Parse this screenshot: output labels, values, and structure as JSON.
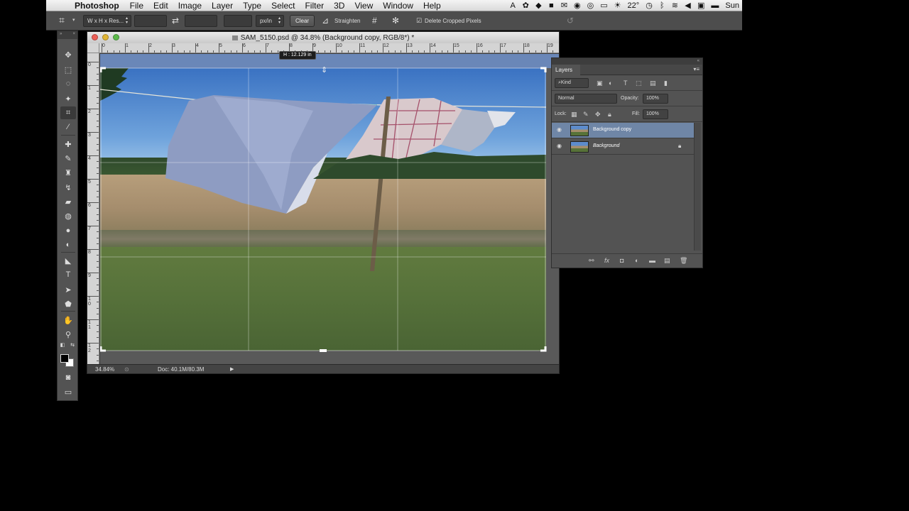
{
  "menubar": {
    "apple_icon": "apple-icon",
    "app_name": "Photoshop",
    "menus": [
      "File",
      "Edit",
      "Image",
      "Layer",
      "Type",
      "Select",
      "Filter",
      "3D",
      "View",
      "Window",
      "Help"
    ],
    "temperature": "22°",
    "day": "Sun"
  },
  "options_bar": {
    "ratio_preset": "W x H x Res...",
    "width_value": "",
    "height_value": "",
    "resolution_value": "",
    "resolution_unit": "px/in",
    "clear_label": "Clear",
    "straighten_label": "Straighten",
    "delete_cropped_label": "Delete Cropped Pixels",
    "delete_cropped_checked": true
  },
  "document": {
    "title": "SAM_5150.psd @ 34.8% (Background copy, RGB/8*) *",
    "ruler_h_labels": [
      "0",
      "1",
      "2",
      "3",
      "4",
      "5",
      "6",
      "7",
      "8",
      "9",
      "10",
      "11",
      "12",
      "13",
      "14",
      "15",
      "16",
      "17",
      "18",
      "19"
    ],
    "ruler_v_labels": [
      "0",
      "1",
      "2",
      "3",
      "4",
      "5",
      "6",
      "7",
      "8",
      "9",
      "1 0",
      "1 1",
      "1 2"
    ],
    "crop_tooltip": "H : 12.129 in",
    "zoom": "34.84%",
    "doc_size": "Doc: 40.1M/80.3M"
  },
  "layers_panel": {
    "tab_label": "Layers",
    "filter_label": "Kind",
    "blend_mode": "Normal",
    "opacity_label": "Opacity:",
    "opacity_value": "100%",
    "lock_label": "Lock:",
    "fill_label": "Fill:",
    "fill_value": "100%",
    "layers": [
      {
        "name": "Background copy",
        "selected": true,
        "locked": false
      },
      {
        "name": "Background",
        "selected": false,
        "locked": true
      }
    ]
  },
  "colors": {
    "panel_bg": "#535353",
    "selected_layer": "#6f86a6",
    "menubar_bg": "#e6e6e6"
  }
}
